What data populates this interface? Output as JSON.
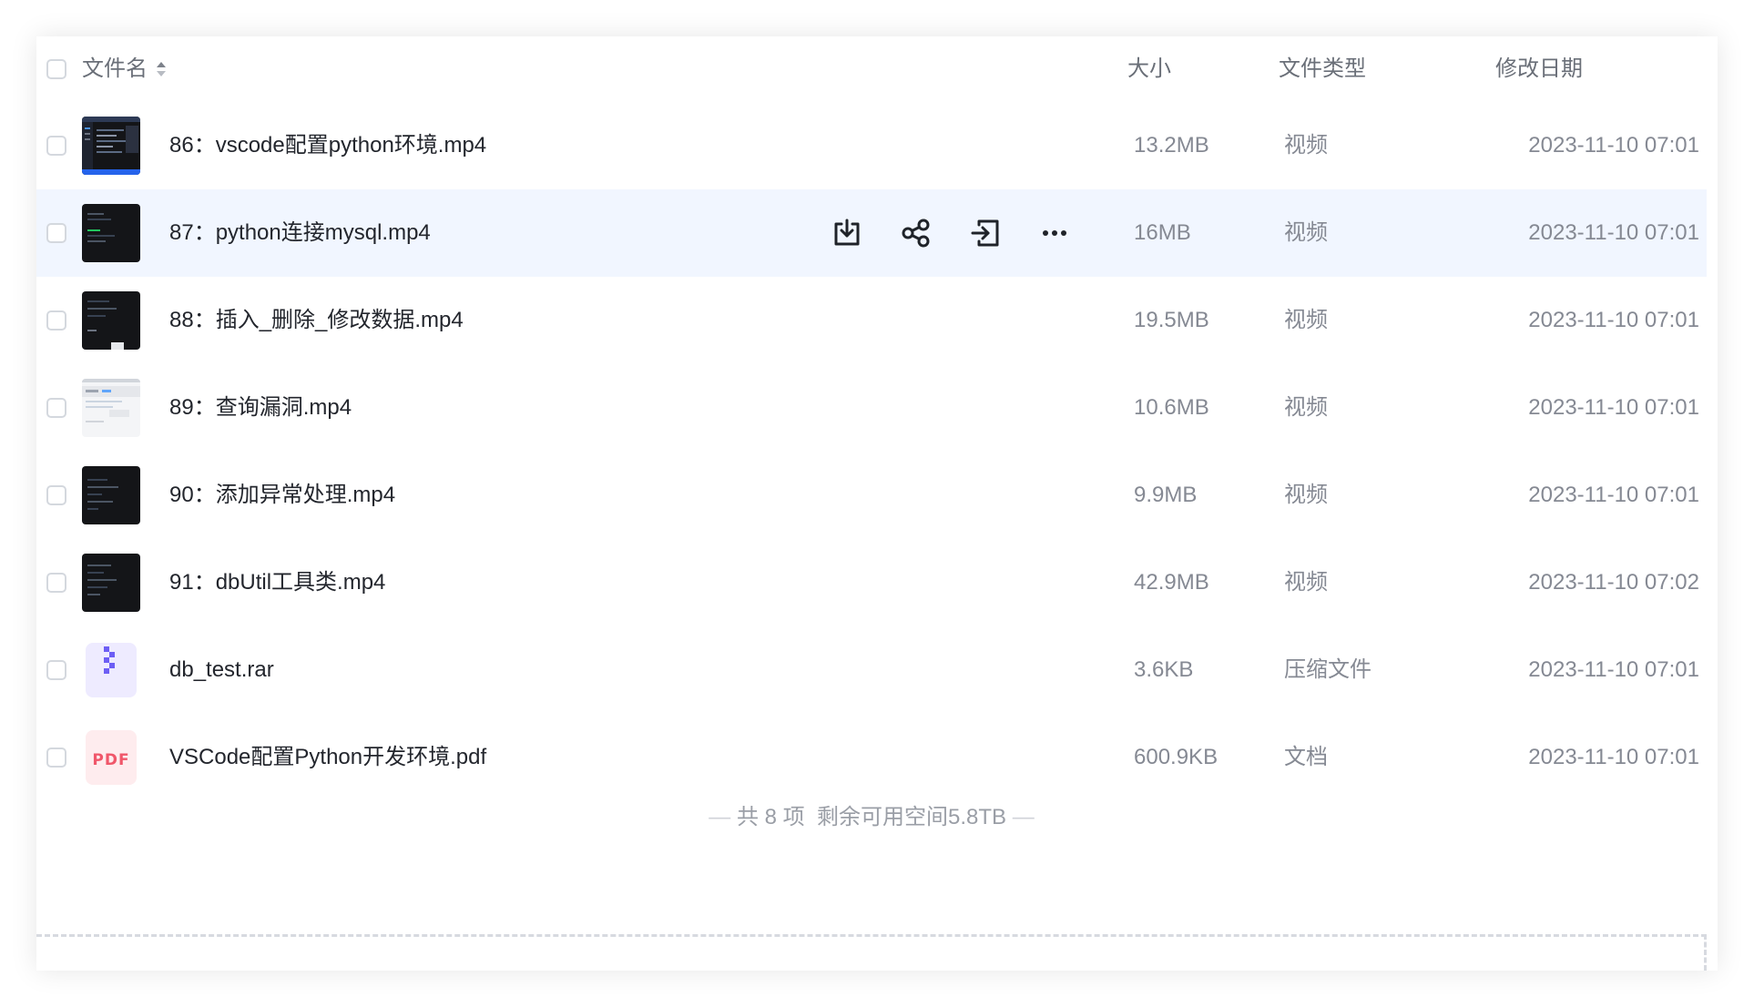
{
  "header": {
    "name_label": "文件名",
    "size_label": "大小",
    "type_label": "文件类型",
    "date_label": "修改日期"
  },
  "files": [
    {
      "name": "86：vscode配置python环境.mp4",
      "size": "13.2MB",
      "type": "视频",
      "date": "2023-11-10 07:01",
      "icon": "video-thumbnail"
    },
    {
      "name": "87：python连接mysql.mp4",
      "size": "16MB",
      "type": "视频",
      "date": "2023-11-10 07:01",
      "icon": "video-thumbnail"
    },
    {
      "name": "88：插入_删除_修改数据.mp4",
      "size": "19.5MB",
      "type": "视频",
      "date": "2023-11-10 07:01",
      "icon": "video-thumbnail"
    },
    {
      "name": "89：查询漏洞.mp4",
      "size": "10.6MB",
      "type": "视频",
      "date": "2023-11-10 07:01",
      "icon": "video-thumbnail"
    },
    {
      "name": "90：添加异常处理.mp4",
      "size": "9.9MB",
      "type": "视频",
      "date": "2023-11-10 07:01",
      "icon": "video-thumbnail"
    },
    {
      "name": "91：dbUtil工具类.mp4",
      "size": "42.9MB",
      "type": "视频",
      "date": "2023-11-10 07:02",
      "icon": "video-thumbnail"
    },
    {
      "name": "db_test.rar",
      "size": "3.6KB",
      "type": "压缩文件",
      "date": "2023-11-10 07:01",
      "icon": "archive-icon"
    },
    {
      "name": "VSCode配置Python开发环境.pdf",
      "size": "600.9KB",
      "type": "文档",
      "date": "2023-11-10 07:01",
      "icon": "pdf-icon",
      "icon_text": "PDF"
    }
  ],
  "row_actions": [
    "download-icon",
    "share-icon",
    "move-icon",
    "more-icon"
  ],
  "footer": {
    "summary": "共 8 项  剩余可用空间5.8TB",
    "dash_left": "—",
    "dash_right": "—"
  },
  "colors": {
    "hover_row": "#f1f6ff",
    "text_primary": "#23262d",
    "text_secondary": "#858993",
    "archive_accent": "#6d5ef5",
    "pdf_accent": "#f0576a"
  }
}
